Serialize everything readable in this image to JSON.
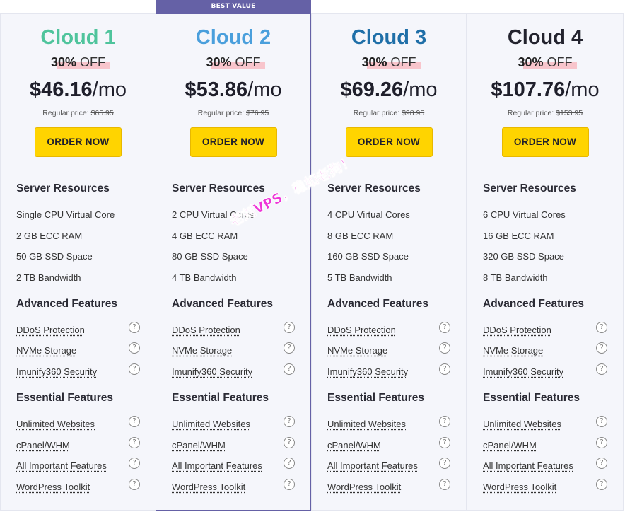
{
  "plans": [
    {
      "name": "Cloud 1",
      "name_color": "#4fc49c",
      "discount_pct": "30%",
      "discount_off": "OFF",
      "price_amount": "$46.16",
      "price_period": "/mo",
      "regular_label": "Regular price:",
      "regular_price": "$65.95",
      "order_label": "ORDER NOW",
      "server_resources_title": "Server Resources",
      "server_resources": [
        "Single CPU Virtual Core",
        "2 GB ECC RAM",
        "50 GB SSD Space",
        "2 TB Bandwidth"
      ],
      "advanced_title": "Advanced Features",
      "advanced": [
        "DDoS Protection",
        "NVMe Storage",
        "Imunify360 Security"
      ],
      "essential_title": "Essential Features",
      "essential": [
        "Unlimited Websites",
        "cPanel/WHM",
        "All Important Features",
        "WordPress Toolkit"
      ]
    },
    {
      "name": "Cloud 2",
      "name_color": "#4a9fdc",
      "badge": "BEST VALUE",
      "discount_pct": "30%",
      "discount_off": "OFF",
      "price_amount": "$53.86",
      "price_period": "/mo",
      "regular_label": "Regular price:",
      "regular_price": "$76.95",
      "order_label": "ORDER NOW",
      "server_resources_title": "Server Resources",
      "server_resources": [
        "2 CPU Virtual Cores",
        "4 GB ECC RAM",
        "80 GB SSD Space",
        "4 TB Bandwidth"
      ],
      "advanced_title": "Advanced Features",
      "advanced": [
        "DDoS Protection",
        "NVMe Storage",
        "Imunify360 Security"
      ],
      "essential_title": "Essential Features",
      "essential": [
        "Unlimited Websites",
        "cPanel/WHM",
        "All Important Features",
        "WordPress Toolkit"
      ]
    },
    {
      "name": "Cloud 3",
      "name_color": "#1f6fa8",
      "discount_pct": "30%",
      "discount_off": "OFF",
      "price_amount": "$69.26",
      "price_period": "/mo",
      "regular_label": "Regular price:",
      "regular_price": "$98.95",
      "order_label": "ORDER NOW",
      "server_resources_title": "Server Resources",
      "server_resources": [
        "4 CPU Virtual Cores",
        "8 GB ECC RAM",
        "160 GB SSD Space",
        "5 TB Bandwidth"
      ],
      "advanced_title": "Advanced Features",
      "advanced": [
        "DDoS Protection",
        "NVMe Storage",
        "Imunify360 Security"
      ],
      "essential_title": "Essential Features",
      "essential": [
        "Unlimited Websites",
        "cPanel/WHM",
        "All Important Features",
        "WordPress Toolkit"
      ]
    },
    {
      "name": "Cloud 4",
      "name_color": "#23232e",
      "discount_pct": "30%",
      "discount_off": "OFF",
      "price_amount": "$107.76",
      "price_period": "/mo",
      "regular_label": "Regular price:",
      "regular_price": "$153.95",
      "order_label": "ORDER NOW",
      "server_resources_title": "Server Resources",
      "server_resources": [
        "6 CPU Virtual Cores",
        "16 GB ECC RAM",
        "320 GB SSD Space",
        "8 TB Bandwidth"
      ],
      "advanced_title": "Advanced Features",
      "advanced": [
        "DDoS Protection",
        "NVMe Storage",
        "Imunify360 Security"
      ],
      "essential_title": "Essential Features",
      "essential": [
        "Unlimited Websites",
        "cPanel/WHM",
        "All Important Features",
        "WordPress Toolkit"
      ]
    }
  ],
  "help_icon_glyph": "?",
  "watermark": "老刘VPS，稳如老狗！",
  "colors": {
    "badge_bg": "#6561a6",
    "button_bg": "#ffd400",
    "discount_highlight": "#f8c5cc",
    "watermark": "#ee35d8"
  }
}
